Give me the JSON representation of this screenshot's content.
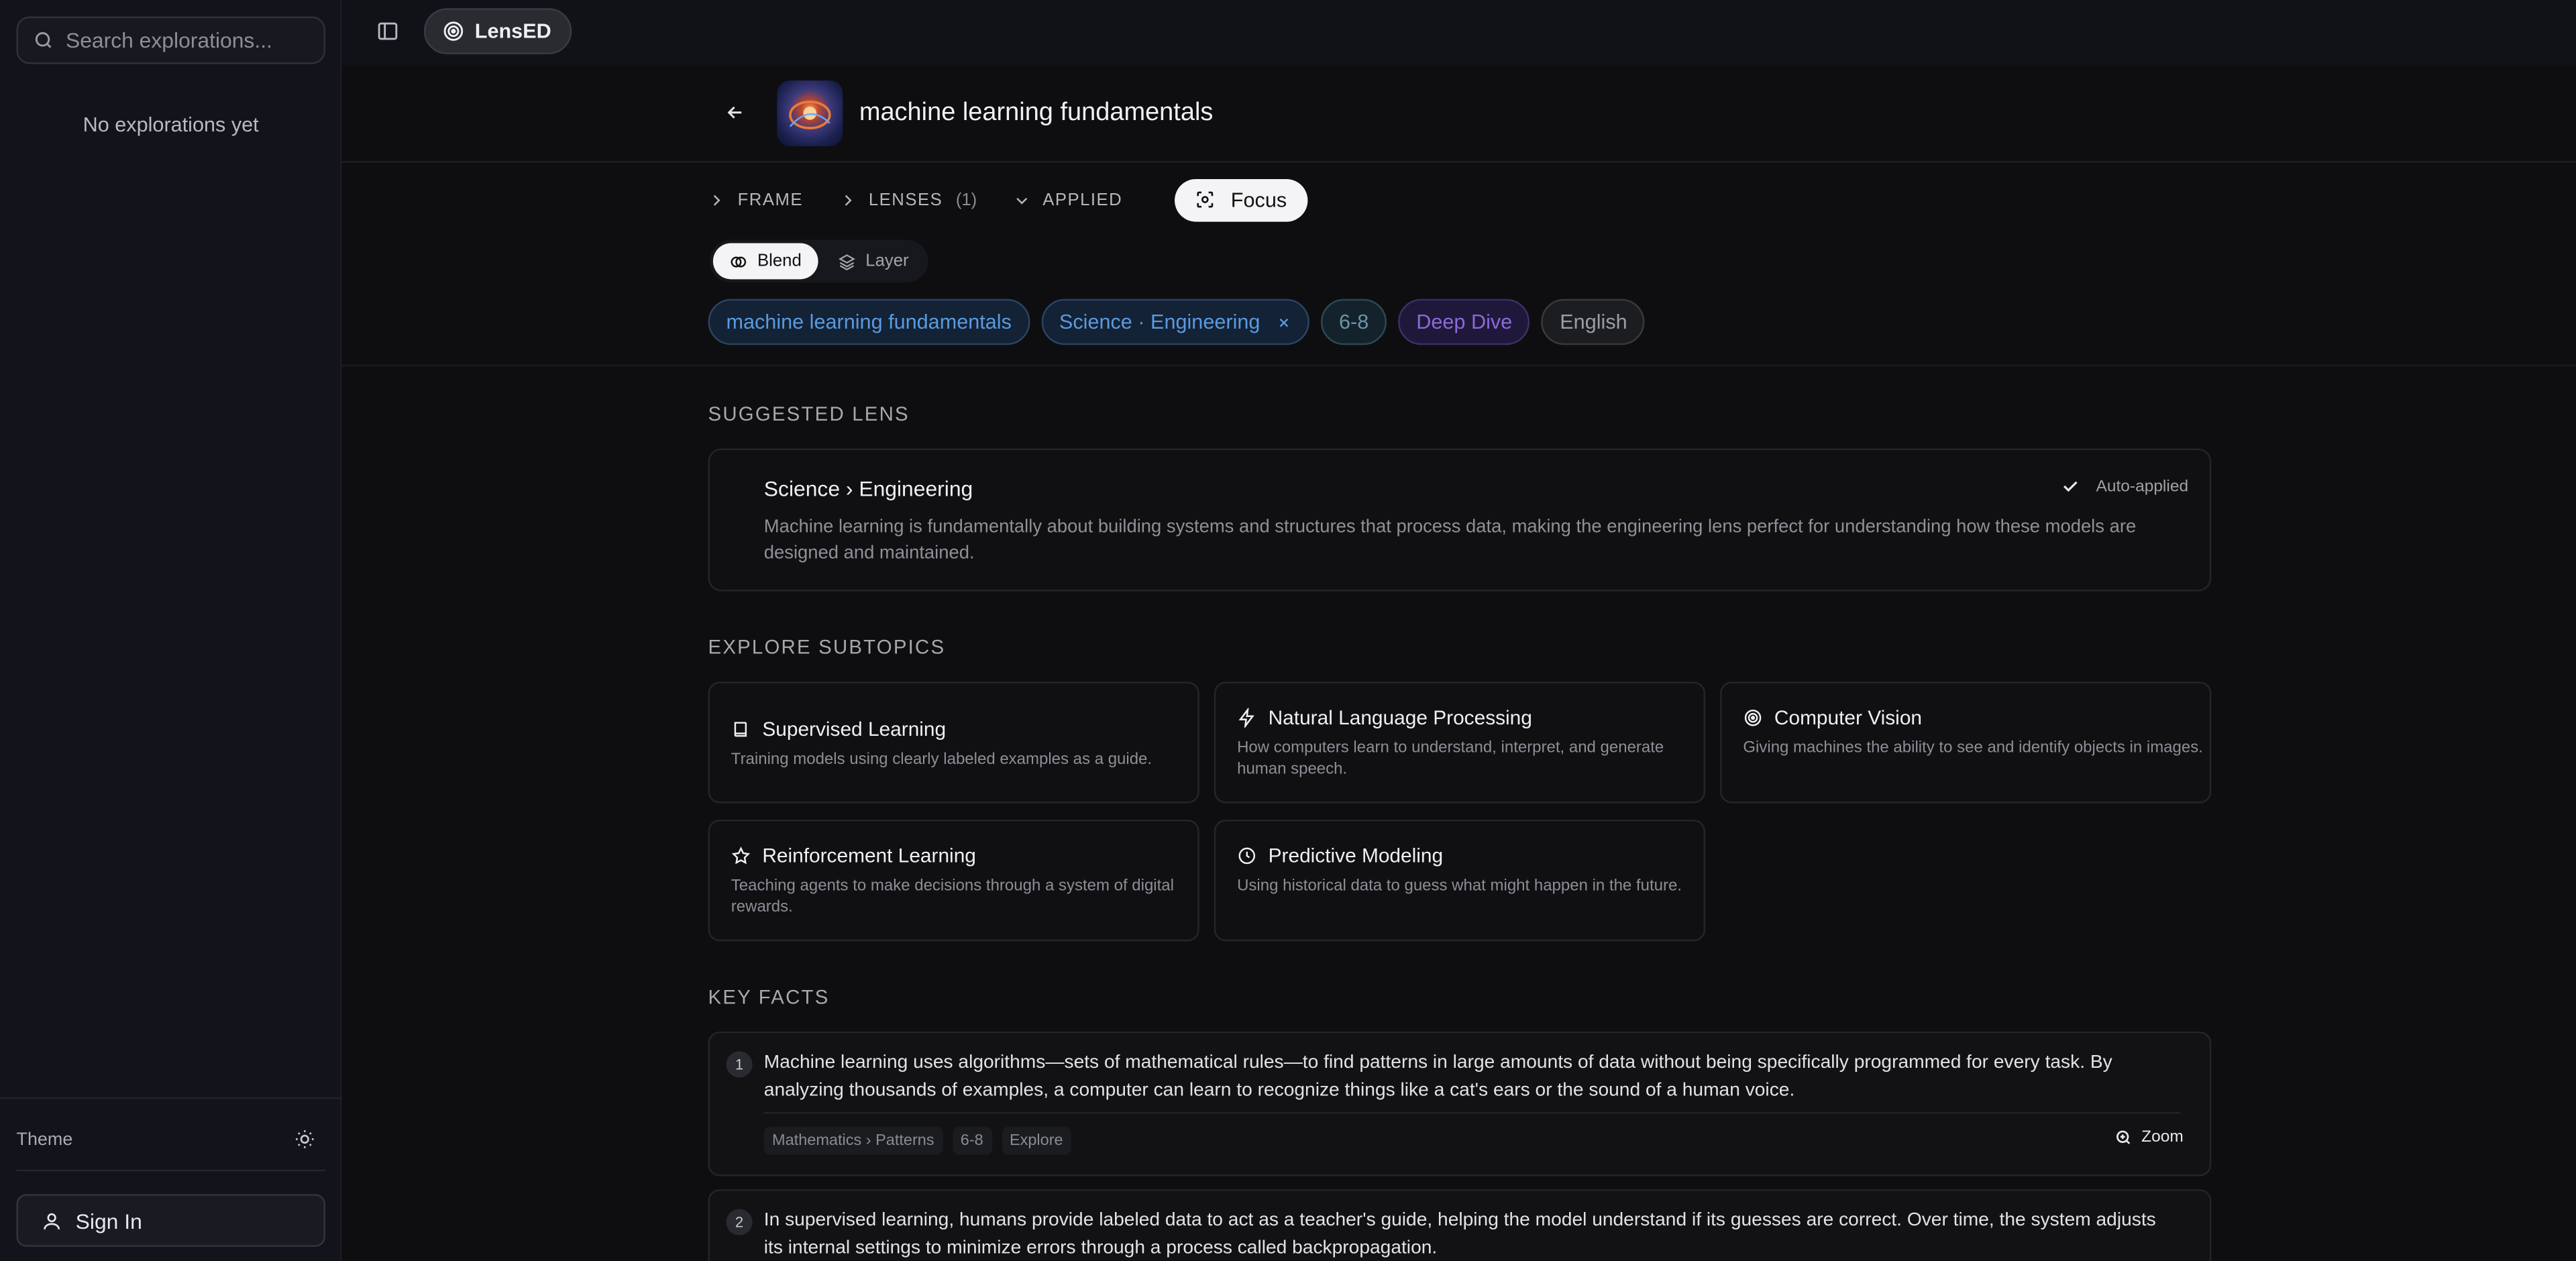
{
  "sidebar": {
    "search_placeholder": "Search explorations...",
    "empty_text": "No explorations yet",
    "theme_label": "Theme",
    "sign_in_label": "Sign In"
  },
  "topbar": {
    "brand": "LensED"
  },
  "header": {
    "title": "machine learning fundamentals"
  },
  "frame_row": {
    "frame": "FRAME",
    "lenses": "LENSES",
    "lenses_count": "(1)",
    "applied": "APPLIED",
    "focus": "Focus"
  },
  "mode": {
    "blend": "Blend",
    "layer": "Layer",
    "selected": "Blend"
  },
  "chips": [
    {
      "label": "machine learning fundamentals",
      "color": "#5a9ae0"
    },
    {
      "label": "Science · Engineering",
      "color": "#5a9ae0",
      "removable": true
    },
    {
      "label": "6-8",
      "color": "#6a95a7"
    },
    {
      "label": "Deep Dive",
      "color": "#8a6ad8"
    },
    {
      "label": "English",
      "color": "#9c9da4"
    }
  ],
  "suggested": {
    "section_title": "SUGGESTED LENS",
    "name": "Science › Engineering",
    "status": "Auto-applied",
    "description": "Machine learning is fundamentally about building systems and structures that process data, making the engineering lens perfect for understanding how these models are designed and maintained."
  },
  "subtopics": {
    "section_title": "EXPLORE SUBTOPICS",
    "items": [
      {
        "icon": "book-icon",
        "title": "Supervised Learning",
        "desc": "Training models using clearly labeled examples as a guide."
      },
      {
        "icon": "lightning-icon",
        "title": "Natural Language Processing",
        "desc": "How computers learn to understand, interpret, and generate human speech."
      },
      {
        "icon": "target-icon",
        "title": "Computer Vision",
        "desc": "Giving machines the ability to see and identify objects in images."
      },
      {
        "icon": "star-icon",
        "title": "Reinforcement Learning",
        "desc": "Teaching agents to make decisions through a system of digital rewards."
      },
      {
        "icon": "clock-icon",
        "title": "Predictive Modeling",
        "desc": "Using historical data to guess what might happen in the future."
      }
    ]
  },
  "key_facts": {
    "section_title": "KEY FACTS",
    "zoom_label": "Zoom",
    "items": [
      {
        "num": "1",
        "text": "Machine learning uses algorithms—sets of mathematical rules—to find patterns in large amounts of data without being specifically programmed for every task. By analyzing thousands of examples, a computer can learn to recognize things like a cat's ears or the sound of a human voice.",
        "tags": [
          "Mathematics › Patterns",
          "6-8",
          "Explore"
        ]
      },
      {
        "num": "2",
        "text": "In supervised learning, humans provide labeled data to act as a teacher's guide, helping the model understand if its guesses are correct. Over time, the system adjusts its internal settings to minimize errors through a process called backpropagation."
      }
    ]
  }
}
